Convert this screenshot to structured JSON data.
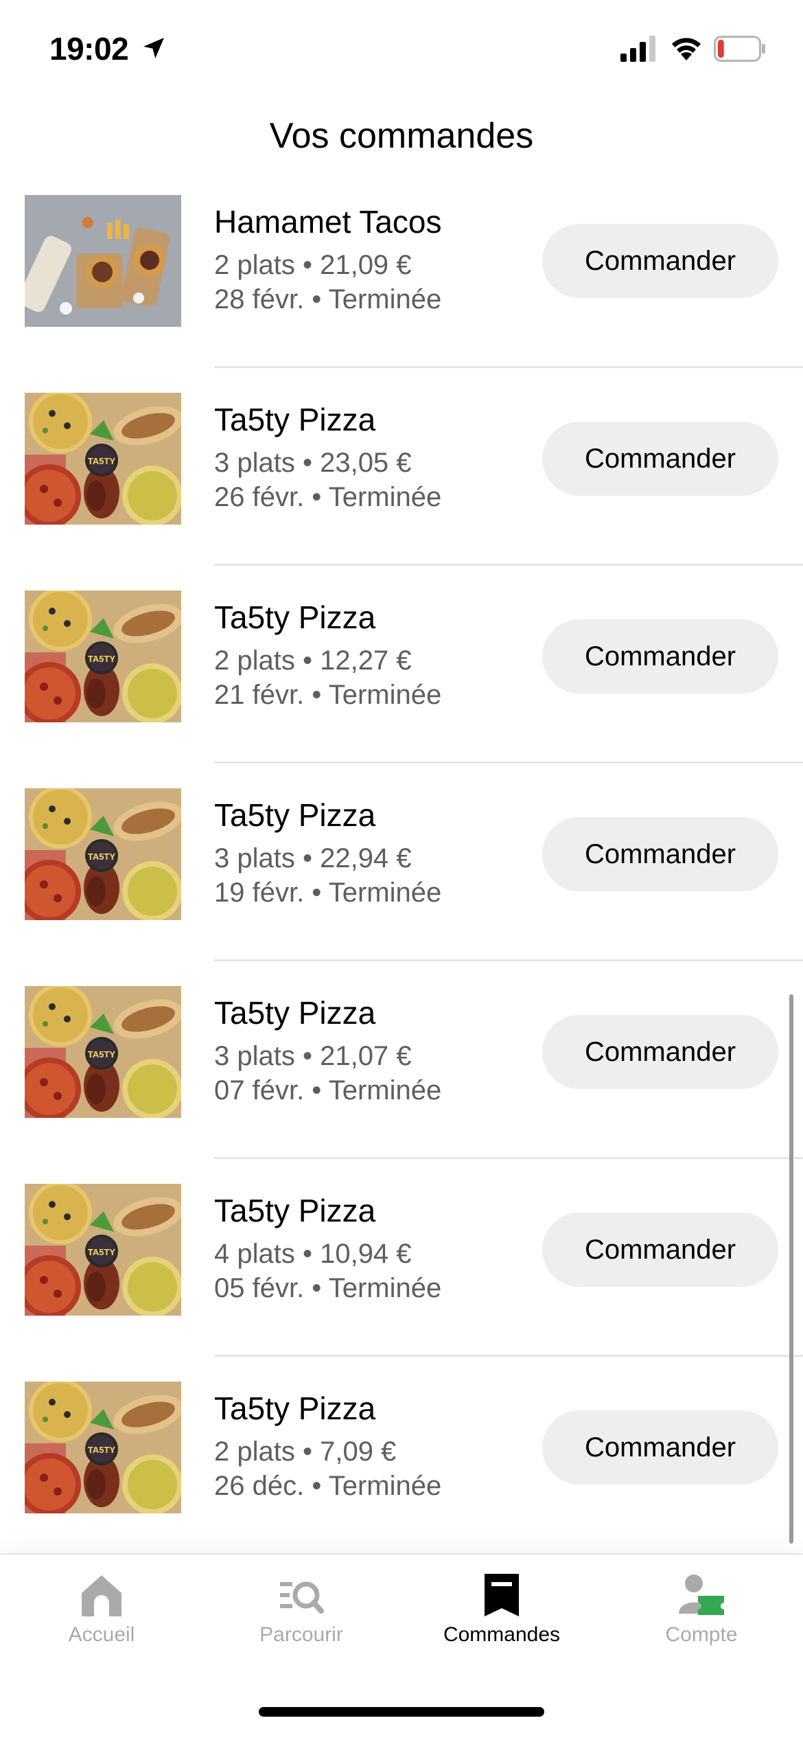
{
  "status_bar": {
    "time": "19:02",
    "battery_level": 0.15
  },
  "page_title": "Vos commandes",
  "orders": [
    {
      "restaurant": "Hamamet Tacos",
      "summary": "2 plats • 21,09 €",
      "date": "28 févr. • Terminée",
      "button": "Commander",
      "image": "tacos-burgers-photo"
    },
    {
      "restaurant": "Ta5ty Pizza",
      "summary": "3 plats • 23,05 €",
      "date": "26 févr. • Terminée",
      "button": "Commander",
      "image": "pizza-photo"
    },
    {
      "restaurant": "Ta5ty Pizza",
      "summary": "2 plats • 12,27 €",
      "date": "21 févr. • Terminée",
      "button": "Commander",
      "image": "pizza-photo"
    },
    {
      "restaurant": "Ta5ty Pizza",
      "summary": "3 plats • 22,94 €",
      "date": "19 févr. • Terminée",
      "button": "Commander",
      "image": "pizza-photo"
    },
    {
      "restaurant": "Ta5ty Pizza",
      "summary": "3 plats • 21,07 €",
      "date": "07 févr. • Terminée",
      "button": "Commander",
      "image": "pizza-photo"
    },
    {
      "restaurant": "Ta5ty Pizza",
      "summary": "4 plats • 10,94 €",
      "date": "05 févr. • Terminée",
      "button": "Commander",
      "image": "pizza-photo"
    },
    {
      "restaurant": "Ta5ty Pizza",
      "summary": "2 plats • 7,09 €",
      "date": "26 déc. • Terminée",
      "button": "Commander",
      "image": "pizza-photo"
    }
  ],
  "tab_bar": {
    "active": "Commandes",
    "tabs": [
      {
        "label": "Accueil",
        "icon": "home-icon"
      },
      {
        "label": "Parcourir",
        "icon": "browse-search-icon"
      },
      {
        "label": "Commandes",
        "icon": "receipt-icon"
      },
      {
        "label": "Compte",
        "icon": "account-ticket-icon"
      }
    ]
  },
  "colors": {
    "button_bg": "#eeeeee",
    "secondary_text": "#5e5e5e",
    "inactive_tab": "#aaaaaa",
    "account_accent": "#34a853"
  }
}
